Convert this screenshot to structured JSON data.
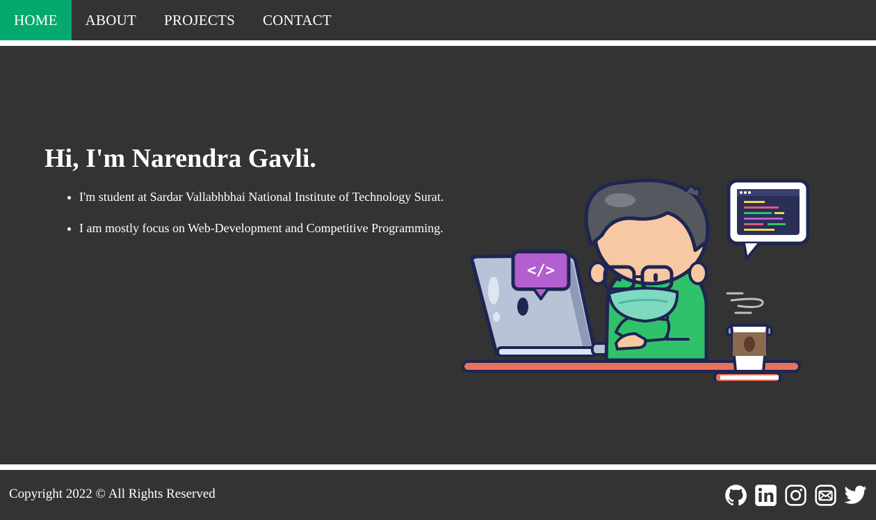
{
  "nav": {
    "items": [
      {
        "label": "HOME",
        "active": true
      },
      {
        "label": "ABOUT",
        "active": false
      },
      {
        "label": "PROJECTS",
        "active": false
      },
      {
        "label": "CONTACT",
        "active": false
      }
    ]
  },
  "hero": {
    "title": "Hi, I'm Narendra Gavli.",
    "bio": [
      "I'm student at Sardar Vallabhbhai National Institute of Technology Surat.",
      "I am mostly focus on Web-Development and Competitive Programming."
    ],
    "illustration_code_badge": "</>"
  },
  "footer": {
    "copyright": "Copyright 2022 © All Rights Reserved",
    "socials": [
      "github-icon",
      "linkedin-icon",
      "instagram-icon",
      "mail-icon",
      "twitter-icon"
    ]
  },
  "colors": {
    "background": "#333333",
    "accent": "#04aa6d",
    "text": "#ffffff",
    "divider": "#ffffff"
  }
}
